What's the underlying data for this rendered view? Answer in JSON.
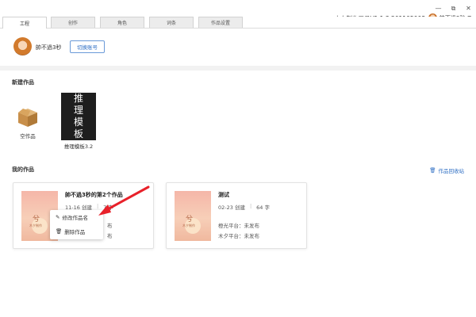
{
  "window": {
    "controls": [
      "—",
      "⧉",
      "✕"
    ]
  },
  "tabs": [
    {
      "label": "工程",
      "active": true
    },
    {
      "label": "创作",
      "active": false
    },
    {
      "label": "角色",
      "active": false
    },
    {
      "label": "词条",
      "active": false
    },
    {
      "label": "作品设置",
      "active": false
    }
  ],
  "header": {
    "version": "木夕制作工具V1.1.3.201105008",
    "username": "帥不過3秒"
  },
  "profile": {
    "name": "帥不過3秒",
    "switch_button": "切换账号"
  },
  "new_works": {
    "section_title": "新建作品",
    "empty_label": "空作品",
    "template_label": "推理模板3.2",
    "template_thumb_text": [
      "推",
      "理",
      "模",
      "板"
    ]
  },
  "my_works": {
    "section_title": "我的作品",
    "recycle_bin": "作品回收站",
    "cards": [
      {
        "title": "帥不過3秒的第2个作品",
        "date": "11-16 创建",
        "chars": "7 字",
        "line1_partial": "布",
        "line2_partial": "布",
        "thumb_text": "兮",
        "thumb_sub": "木夕制作"
      },
      {
        "title": "测试",
        "date": "02-23 创建",
        "chars": "64 字",
        "line1": "橙光平台：未发布",
        "line2": "木夕平台：未发布",
        "thumb_text": "兮",
        "thumb_sub": "木夕制作"
      }
    ],
    "context_menu": {
      "rename": "修改作品名",
      "delete": "删除作品"
    }
  },
  "colors": {
    "accent": "#2f6fc4",
    "arrow": "#e8212a"
  }
}
